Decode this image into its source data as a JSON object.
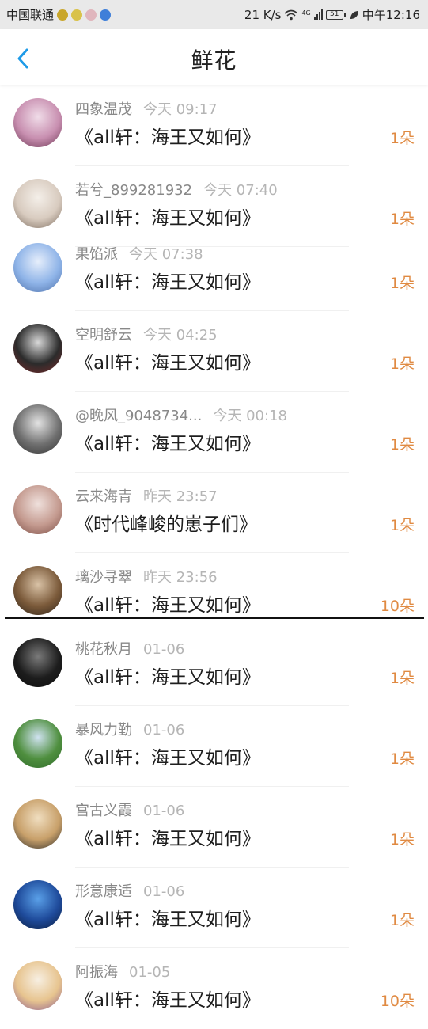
{
  "status_bar": {
    "carrier": "中国联通",
    "speed": "21 K/s",
    "network": "4G",
    "battery": "51",
    "time": "中午12:16"
  },
  "header": {
    "title": "鲜花",
    "back_icon": "chevron-left-icon",
    "accent": "#1E9BE8"
  },
  "colors": {
    "count": "#E08A42",
    "divider": "#111111"
  },
  "items": [
    {
      "name": "四象温茂",
      "time": "今天 09:17",
      "book": "《all轩：海王又如何》",
      "count": "1朵"
    },
    {
      "name": "若兮_899281932",
      "time": "今天 07:40",
      "book": "《all轩：海王又如何》",
      "count": "1朵"
    },
    {
      "name": "果馅派",
      "time": "今天 07:38",
      "book": "《all轩：海王又如何》",
      "count": "1朵"
    },
    {
      "name": "空明舒云",
      "time": "今天 04:25",
      "book": "《all轩：海王又如何》",
      "count": "1朵"
    },
    {
      "name": "@晚风_9048734...",
      "time": "今天 00:18",
      "book": "《all轩：海王又如何》",
      "count": "1朵"
    },
    {
      "name": "云来海青",
      "time": "昨天 23:57",
      "book": "《时代峰峻的崽子们》",
      "count": "1朵"
    },
    {
      "name": "璃沙寻翠",
      "time": "昨天 23:56",
      "book": "《all轩：海王又如何》",
      "count": "10朵"
    },
    {
      "name": "桃花秋月",
      "time": "01-06",
      "book": "《all轩：海王又如何》",
      "count": "1朵"
    },
    {
      "name": "暴风力勤",
      "time": "01-06",
      "book": "《all轩：海王又如何》",
      "count": "1朵"
    },
    {
      "name": "宫古义霞",
      "time": "01-06",
      "book": "《all轩：海王又如何》",
      "count": "1朵"
    },
    {
      "name": "形意康适",
      "time": "01-06",
      "book": "《all轩：海王又如何》",
      "count": "1朵"
    },
    {
      "name": "阿振海",
      "time": "01-05",
      "book": "《all轩：海王又如何》",
      "count": "10朵"
    }
  ]
}
